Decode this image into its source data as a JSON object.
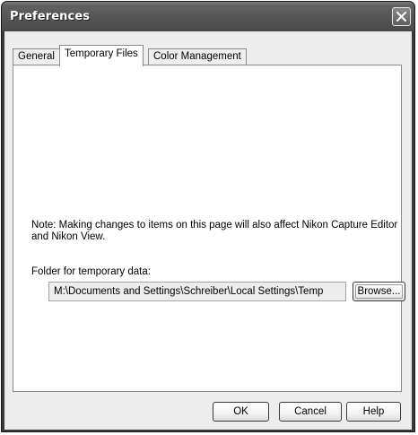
{
  "window": {
    "title": "Preferences"
  },
  "tabs": [
    {
      "label": "General",
      "selected": false
    },
    {
      "label": "Temporary Files",
      "selected": true
    },
    {
      "label": "Color Management",
      "selected": false
    }
  ],
  "temporary_files": {
    "note": "Note: Making changes to items on this page will also affect Nikon Capture Editor and Nikon View.",
    "folder_label": "Folder for temporary data:",
    "folder_path": "M:\\Documents and Settings\\Schreiber\\Local Settings\\Temp",
    "browse_label": "Browse..."
  },
  "buttons": {
    "ok": "OK",
    "cancel": "Cancel",
    "help": "Help"
  },
  "icons": {
    "close": "close-icon"
  },
  "colors": {
    "titlebar": "#575757",
    "dialog_background": "#ededed",
    "panel_background": "#ffffff"
  }
}
